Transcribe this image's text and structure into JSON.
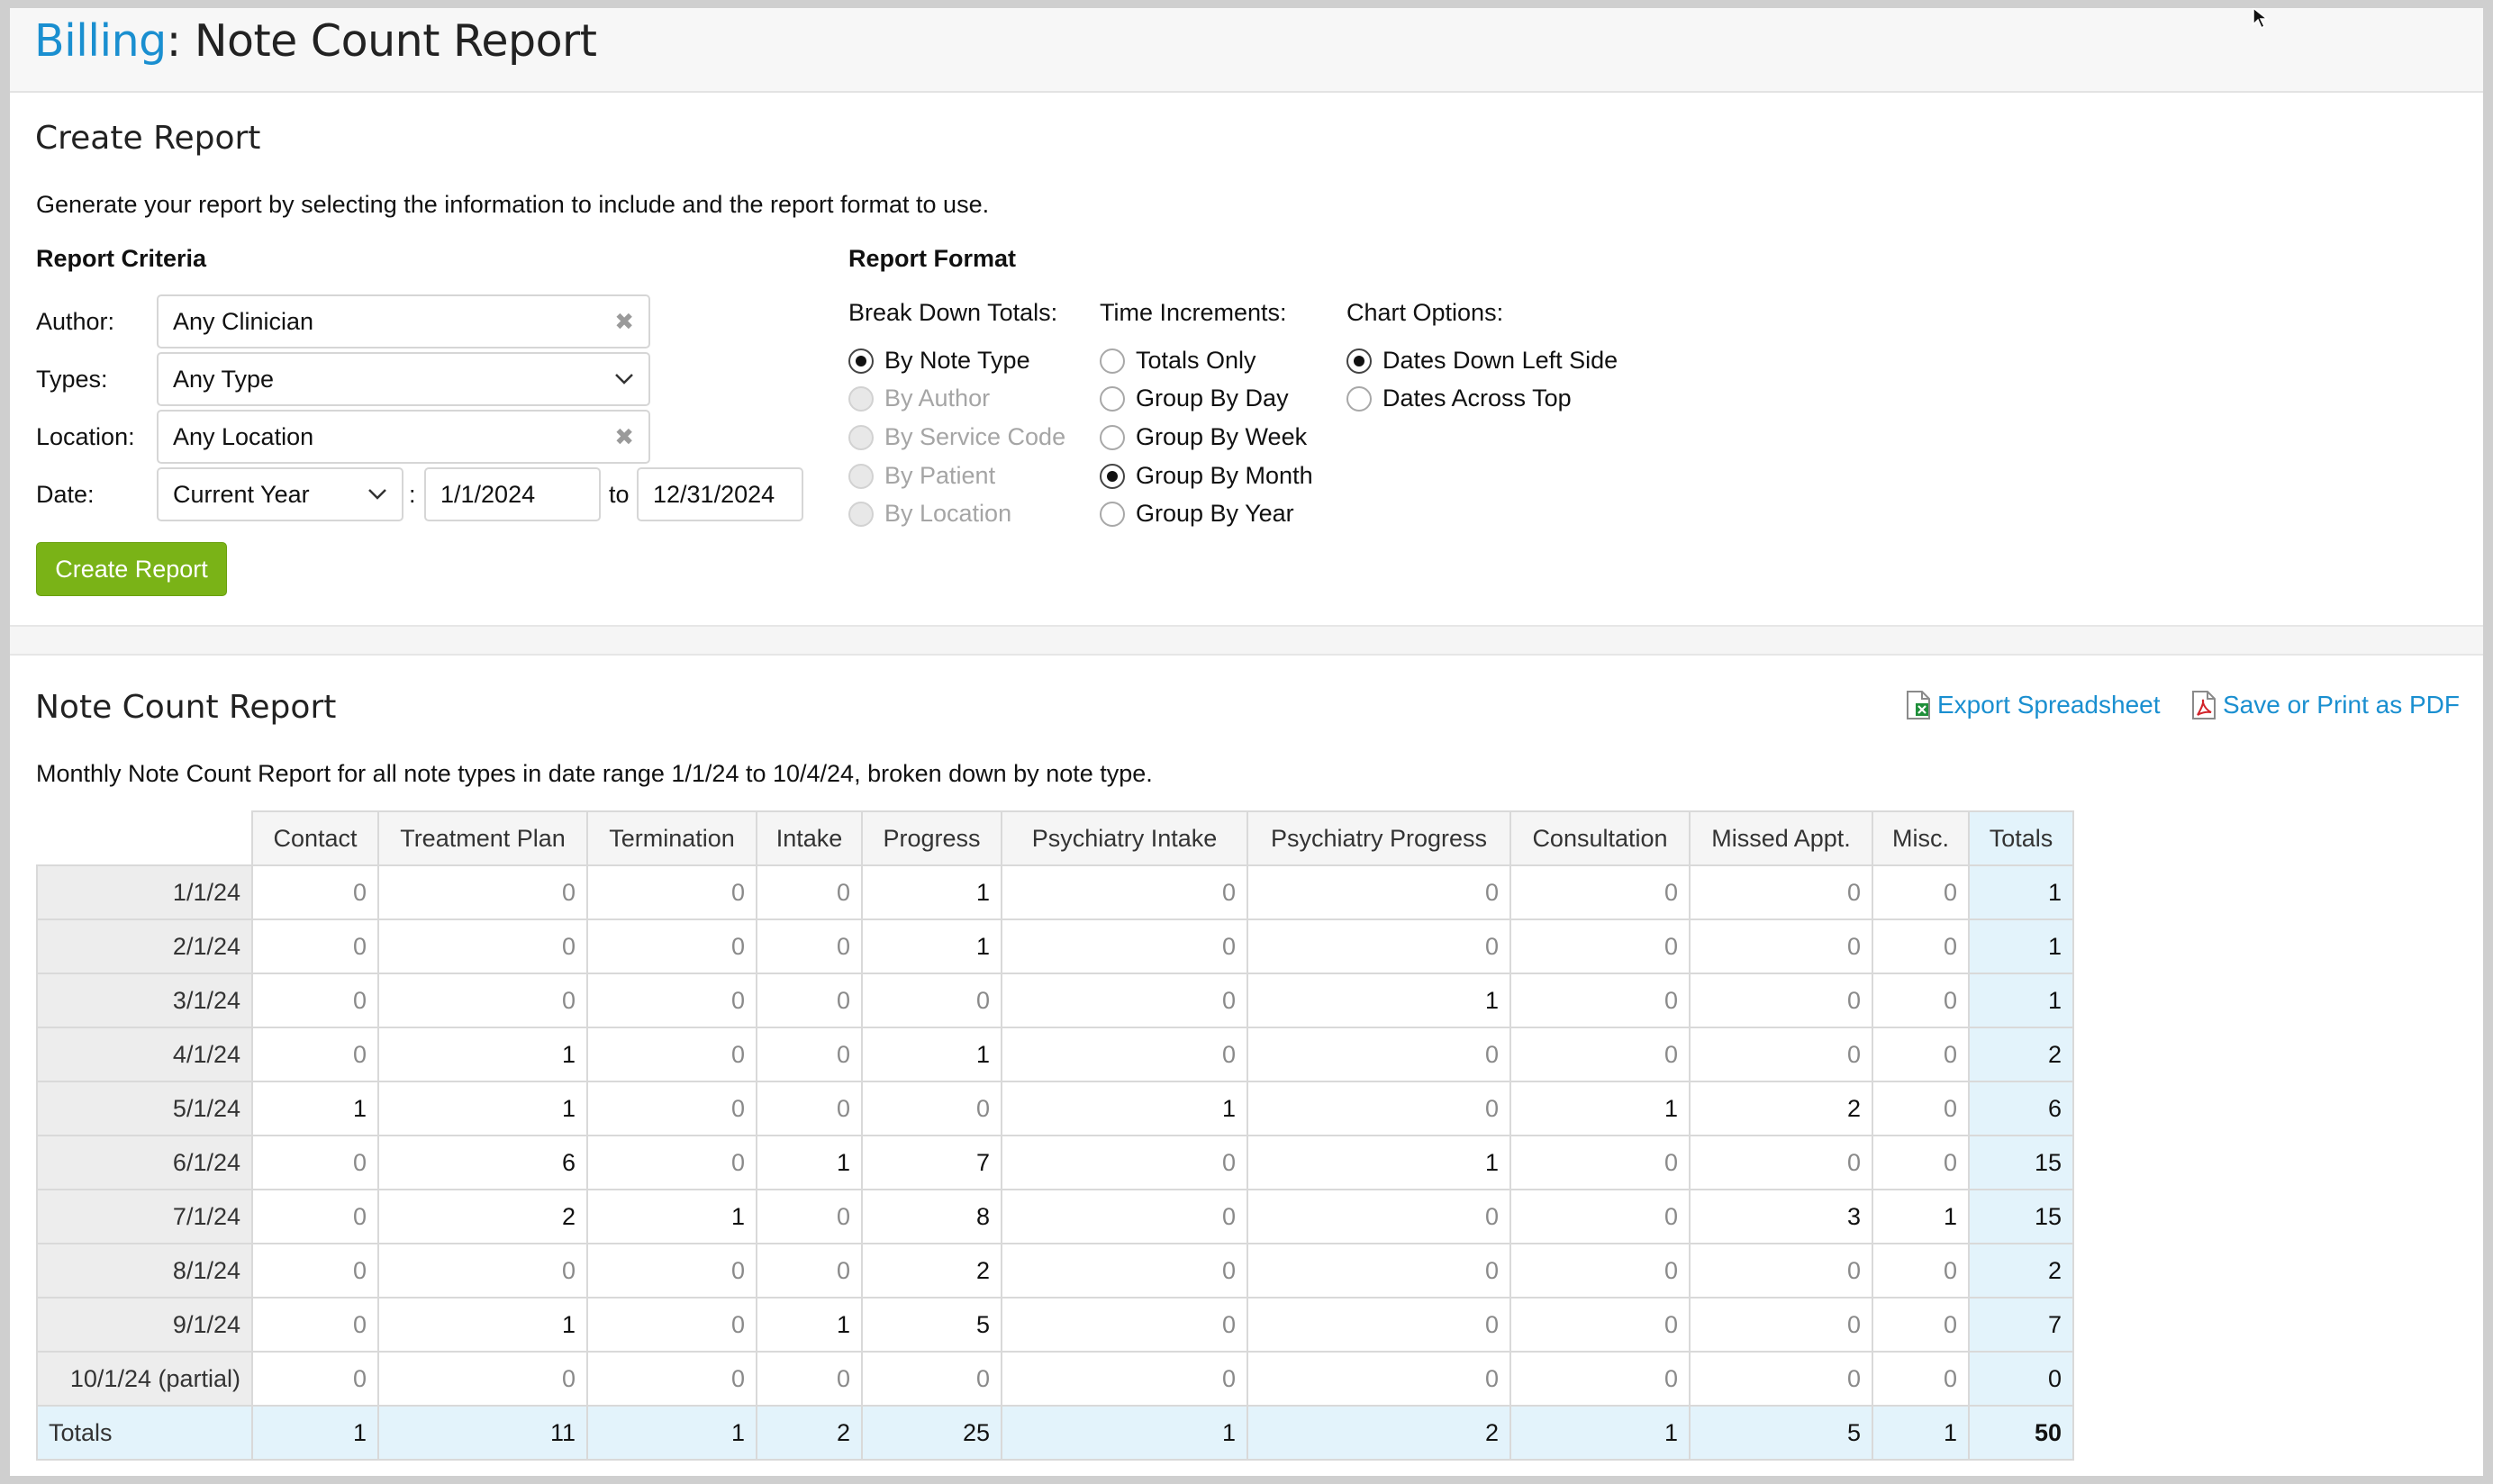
{
  "header": {
    "crumb": "Billing",
    "separator": ":",
    "title": " Note Count Report"
  },
  "create": {
    "heading": "Create Report",
    "description": "Generate your report by selecting the information to include and the report format to use.",
    "criteria": {
      "heading": "Report Criteria",
      "author_label": "Author:",
      "author_value": "Any Clinician",
      "types_label": "Types:",
      "types_value": "Any Type",
      "location_label": "Location:",
      "location_value": "Any Location",
      "date_label": "Date:",
      "date_range": "Current Year",
      "date_colon": ":",
      "date_from": "1/1/2024",
      "date_to_label": "to",
      "date_to": "12/31/2024",
      "clear_glyph": "✖"
    },
    "button": "Create Report",
    "format": {
      "heading": "Report Format",
      "breakdown_label": "Break Down Totals:",
      "breakdown": [
        "By Note Type",
        "By Author",
        "By Service Code",
        "By Patient",
        "By Location"
      ],
      "time_label": "Time Increments:",
      "time": [
        "Totals Only",
        "Group By Day",
        "Group By Week",
        "Group By Month",
        "Group By Year"
      ],
      "chart_label": "Chart Options:",
      "chart": [
        "Dates Down Left Side",
        "Dates Across Top"
      ]
    }
  },
  "report": {
    "heading": "Note Count Report",
    "export_label": "Export Spreadsheet",
    "pdf_label": "Save or Print as PDF",
    "description": "Monthly Note Count Report for all note types in date range 1/1/24 to 10/4/24, broken down by note type.",
    "columns": [
      "Contact",
      "Treatment Plan",
      "Termination",
      "Intake",
      "Progress",
      "Psychiatry Intake",
      "Psychiatry Progress",
      "Consultation",
      "Missed Appt.",
      "Misc.",
      "Totals"
    ],
    "rows": [
      {
        "label": "1/1/24",
        "values": [
          0,
          0,
          0,
          0,
          1,
          0,
          0,
          0,
          0,
          0,
          1
        ]
      },
      {
        "label": "2/1/24",
        "values": [
          0,
          0,
          0,
          0,
          1,
          0,
          0,
          0,
          0,
          0,
          1
        ]
      },
      {
        "label": "3/1/24",
        "values": [
          0,
          0,
          0,
          0,
          0,
          0,
          1,
          0,
          0,
          0,
          1
        ]
      },
      {
        "label": "4/1/24",
        "values": [
          0,
          1,
          0,
          0,
          1,
          0,
          0,
          0,
          0,
          0,
          2
        ]
      },
      {
        "label": "5/1/24",
        "values": [
          1,
          1,
          0,
          0,
          0,
          1,
          0,
          1,
          2,
          0,
          6
        ]
      },
      {
        "label": "6/1/24",
        "values": [
          0,
          6,
          0,
          1,
          7,
          0,
          1,
          0,
          0,
          0,
          15
        ]
      },
      {
        "label": "7/1/24",
        "values": [
          0,
          2,
          1,
          0,
          8,
          0,
          0,
          0,
          3,
          1,
          15
        ]
      },
      {
        "label": "8/1/24",
        "values": [
          0,
          0,
          0,
          0,
          2,
          0,
          0,
          0,
          0,
          0,
          2
        ]
      },
      {
        "label": "9/1/24",
        "values": [
          0,
          1,
          0,
          1,
          5,
          0,
          0,
          0,
          0,
          0,
          7
        ]
      },
      {
        "label": "10/1/24 (partial)",
        "values": [
          0,
          0,
          0,
          0,
          0,
          0,
          0,
          0,
          0,
          0,
          0
        ]
      }
    ],
    "totals_label": "Totals",
    "totals": [
      1,
      11,
      1,
      2,
      25,
      1,
      2,
      1,
      5,
      1,
      50
    ]
  }
}
